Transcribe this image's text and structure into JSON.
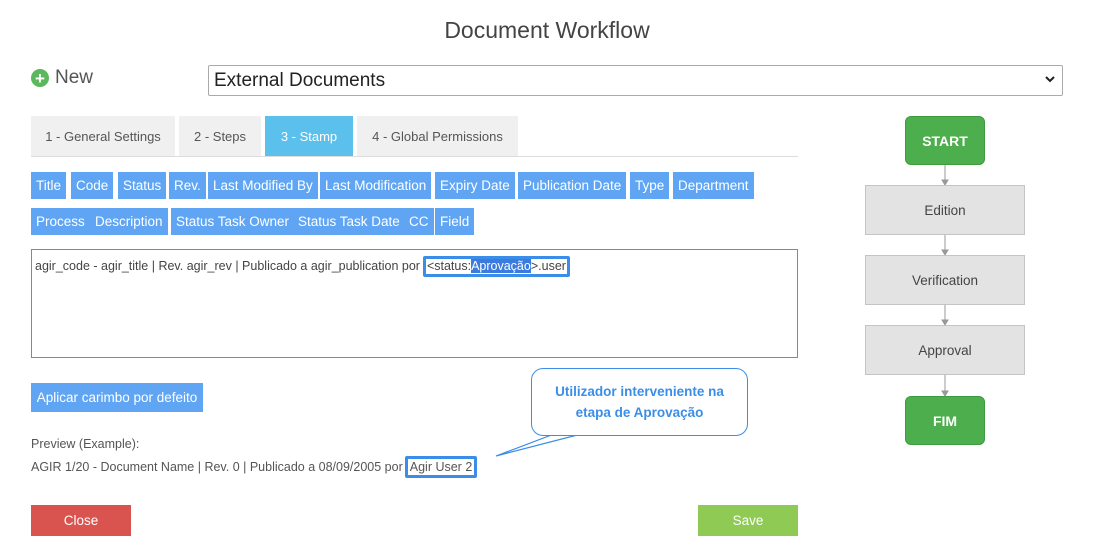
{
  "page": {
    "title": "Document Workflow"
  },
  "toolbar": {
    "new_label": "New"
  },
  "workflow_select": {
    "value": "External Documents"
  },
  "tabs": [
    {
      "label": "1 - General Settings",
      "active": false
    },
    {
      "label": "2 - Steps",
      "active": false
    },
    {
      "label": "3 - Stamp",
      "active": true
    },
    {
      "label": "4 - Global Permissions",
      "active": false
    }
  ],
  "field_buttons_row1": [
    "Title",
    "Code",
    "Status",
    "Rev.",
    "Last Modified By",
    "Last Modification",
    "Expiry Date",
    "Publication Date",
    "Type",
    "Department"
  ],
  "field_buttons_row2": [
    "Process",
    "Description",
    "Status Task Owner",
    "Status Task Date",
    "CC",
    "Field"
  ],
  "stamp": {
    "text_before": "agir_code - agir_title | Rev. agir_rev | Publicado a agir_publication por",
    "token_prefix": "<status:",
    "token_selected": "Aprovação",
    "token_suffix": ">.user"
  },
  "apply_default_label": "Aplicar carimbo por defeito",
  "preview": {
    "label": "Preview (Example):",
    "text_before": "AGIR 1/20 - Document Name | Rev. 0 | Publicado a 08/09/2005 por",
    "highlight": "Agir User 2"
  },
  "callout": {
    "text": "Utilizador interveniente na etapa de Aprovação"
  },
  "buttons": {
    "close": "Close",
    "save": "Save"
  },
  "flow": {
    "start": "START",
    "steps": [
      "Edition",
      "Verification",
      "Approval"
    ],
    "end": "FIM"
  },
  "colors": {
    "accent": "#5fa5f4",
    "tab_active": "#5bc0eb",
    "highlight_border": "#3b8ee8",
    "close": "#d9534f",
    "save": "#8fca55",
    "terminal": "#4cae4c"
  },
  "icons": {
    "new": "plus-circle-icon",
    "dropdown": "chevron-down-icon"
  }
}
